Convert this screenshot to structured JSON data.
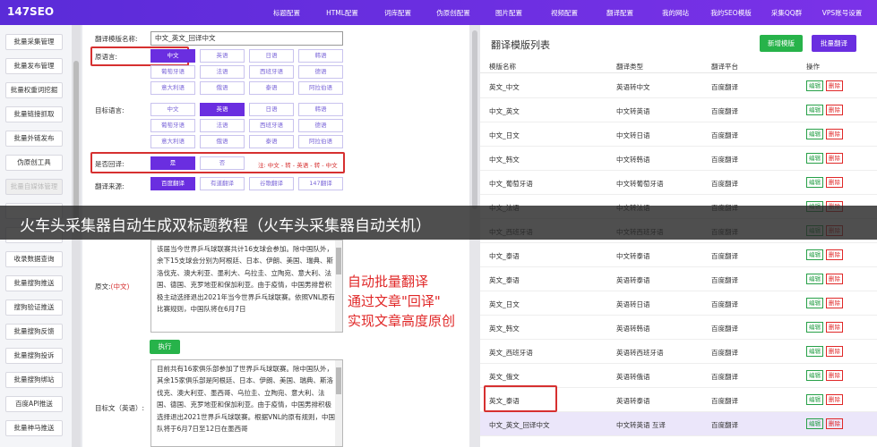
{
  "app": {
    "logo": "147SEO"
  },
  "nav": [
    "标题配置",
    "HTML配置",
    "词库配置",
    "伪原创配置",
    "图片配置",
    "视频配置",
    "翻译配置",
    "我的网站",
    "我的SEO模版",
    "采集QQ群",
    "VPS账号设置"
  ],
  "sidebar": [
    "批量采集管理",
    "批量发布管理",
    "批量权重词挖掘",
    "批量链接抓取",
    "批量外链发布",
    "伪原创工具",
    "批量自媒体管理",
    "",
    "",
    "收录数据查询",
    "批量搜狗推送",
    "搜狗验证推送",
    "批量搜狗反馈",
    "批量搜狗投诉",
    "批量搜狗绑站",
    "百度API推送",
    "批量神马推送"
  ],
  "form": {
    "template_name_label": "翻译模版名称:",
    "template_name_value": "中文_英文_回译中文",
    "source_lang_label": "原语言:",
    "target_lang_label": "目标语言:",
    "source_langs": [
      "中文",
      "英语",
      "日语",
      "韩语",
      "葡萄牙语",
      "法语",
      "西班牙语",
      "德语",
      "意大利语",
      "俄语",
      "泰语",
      "阿拉伯语"
    ],
    "target_langs": [
      "中文",
      "英语",
      "日语",
      "韩语",
      "葡萄牙语",
      "法语",
      "西班牙语",
      "德语",
      "意大利语",
      "俄语",
      "泰语",
      "阿拉伯语"
    ],
    "back_translate_label": "是否回译:",
    "back_yes": "是",
    "back_no": "否",
    "back_note": "注: 中文 - 转 - 英语 - 转 - 中文",
    "source_label": "翻译来源:",
    "sources": [
      "百度翻译",
      "有道翻译",
      "谷歌翻译",
      "147翻译"
    ],
    "original_label": "原文:",
    "original_label_sub": "(中文)",
    "original_text": "该届当今世界乒乓球联赛共计16支球会参加。除中国队外，余下15支球会分别为阿根廷、日本、伊朗、美国、瑞典、斯洛伐克、澳大利亚、墨利大、乌拉圭、立陶宛、意大利、法国、德国、克罗地亚和保加利亚。由于疫情，中国男排曾积极主动选择退出2021年当今世界乒乓球联赛。依照VNL原有比赛规则，中国队将在6月7日",
    "execute": "执行",
    "target_label": "目标文（英语）:",
    "target_text": "目前共有16家俱乐部参加了世界乒乓球联赛。除中国队外，其余15家俱乐部是阿根廷、日本、伊朗、美国、瑞典、斯洛伐克、澳大利亚、墨西哥、乌拉圭、立陶宛、意大利、法国、德国、克罗地亚和保加利亚。由于疫情，中国男排积极选择退出2021世界乒乓球联赛。根据VNL的原有规则，中国队将于6月7日至12日在墨西哥"
  },
  "annotation": [
    "自动批量翻译",
    "通过文章\"回译\"",
    "实现文章高度原创"
  ],
  "right": {
    "title": "翻译模版列表",
    "new_button": "新增模版",
    "batch_button": "批量翻译",
    "columns": [
      "模版名称",
      "翻译类型",
      "翻译平台",
      "操作"
    ],
    "edit": "编辑",
    "delete": "删除",
    "rows": [
      [
        "英文_中文",
        "英语转中文",
        "百度翻译"
      ],
      [
        "中文_英文",
        "中文转英语",
        "百度翻译"
      ],
      [
        "中文_日文",
        "中文转日语",
        "百度翻译"
      ],
      [
        "中文_韩文",
        "中文转韩语",
        "百度翻译"
      ],
      [
        "中文_葡萄牙语",
        "中文转葡萄牙语",
        "百度翻译"
      ],
      [
        "中文_法语",
        "中文转法语",
        "百度翻译"
      ],
      [
        "中文_西班牙语",
        "中文转西班牙语",
        "百度翻译"
      ],
      [
        "中文_泰语",
        "中文转泰语",
        "百度翻译"
      ],
      [
        "英文_泰语",
        "英语转泰语",
        "百度翻译"
      ],
      [
        "英文_日文",
        "英语转日语",
        "百度翻译"
      ],
      [
        "英文_韩文",
        "英语转韩语",
        "百度翻译"
      ],
      [
        "英文_西班牙语",
        "英语转西班牙语",
        "百度翻译"
      ],
      [
        "英文_俄文",
        "英语转俄语",
        "百度翻译"
      ],
      [
        "英文_泰语",
        "英语转泰语",
        "百度翻译"
      ],
      [
        "中文_英文_回译中文",
        "中文转英语 互译",
        "百度翻译"
      ]
    ]
  },
  "banner": {
    "text": "火车头采集器自动生成双标题教程（火车头采集器自动关机）"
  }
}
